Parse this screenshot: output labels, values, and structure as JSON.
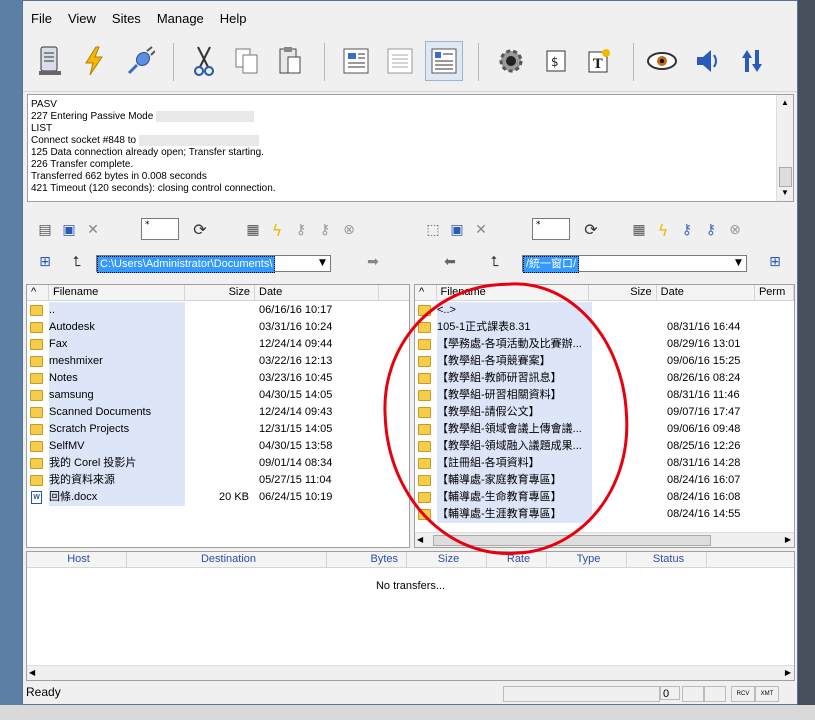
{
  "menu": [
    "File",
    "View",
    "Sites",
    "Manage",
    "Help"
  ],
  "toolbar_icons": [
    "server-icon",
    "lightning-icon",
    "plug-icon",
    "cut-icon",
    "copy-icon",
    "paste-icon",
    "view-text-icon",
    "view-list-icon",
    "view-detail-icon",
    "settings-gear-icon",
    "script-icon",
    "text-file-icon",
    "eye-icon",
    "speaker-icon",
    "transfer-arrows-icon"
  ],
  "log": {
    "lines": [
      "PASV",
      "227 Entering Passive Mode",
      "LIST",
      "Connect socket #848 to",
      "125 Data connection already open; Transfer starting.",
      "226 Transfer complete.",
      "Transferred 662 bytes in 0.008 seconds",
      "421 Timeout (120 seconds): closing control connection."
    ]
  },
  "local": {
    "filter": "*",
    "path": "C:\\Users\\Administrator\\Documents\\",
    "columns": {
      "name": "Filename",
      "size": "Size",
      "date": "Date"
    },
    "files": [
      {
        "name": "..",
        "size": "",
        "date": "06/16/16",
        "time": "10:17",
        "type": "folder"
      },
      {
        "name": "Autodesk",
        "size": "",
        "date": "03/31/16",
        "time": "10:24",
        "type": "folder"
      },
      {
        "name": "Fax",
        "size": "",
        "date": "12/24/14",
        "time": "09:44",
        "type": "folder"
      },
      {
        "name": "meshmixer",
        "size": "",
        "date": "03/22/16",
        "time": "12:13",
        "type": "folder"
      },
      {
        "name": "Notes",
        "size": "",
        "date": "03/23/16",
        "time": "10:45",
        "type": "folder"
      },
      {
        "name": "samsung",
        "size": "",
        "date": "04/30/15",
        "time": "14:05",
        "type": "folder"
      },
      {
        "name": "Scanned Documents",
        "size": "",
        "date": "12/24/14",
        "time": "09:43",
        "type": "folder"
      },
      {
        "name": "Scratch Projects",
        "size": "",
        "date": "12/31/15",
        "time": "14:05",
        "type": "folder"
      },
      {
        "name": "SelfMV",
        "size": "",
        "date": "04/30/15",
        "time": "13:58",
        "type": "folder"
      },
      {
        "name": "我的 Corel 投影片",
        "size": "",
        "date": "09/01/14",
        "time": "08:34",
        "type": "folder"
      },
      {
        "name": "我的資料來源",
        "size": "",
        "date": "05/27/15",
        "time": "11:04",
        "type": "folder"
      },
      {
        "name": "回條.docx",
        "size": "20 KB",
        "date": "06/24/15",
        "time": "10:19",
        "type": "doc"
      }
    ]
  },
  "remote": {
    "filter": "*",
    "path": "/統一窗口/",
    "columns": {
      "name": "Filename",
      "size": "Size",
      "date": "Date",
      "perm": "Perm"
    },
    "files": [
      {
        "name": "<..>",
        "date": "",
        "time": ""
      },
      {
        "name": "105-1正式課表8.31",
        "date": "08/31/16",
        "time": "16:44"
      },
      {
        "name": "【學務處-各項活動及比賽辦...",
        "date": "08/29/16",
        "time": "13:01"
      },
      {
        "name": "【教學組-各項競賽案】",
        "date": "09/06/16",
        "time": "15:25"
      },
      {
        "name": "【教學組-教師研習訊息】",
        "date": "08/26/16",
        "time": "08:24"
      },
      {
        "name": "【教學組-研習相關資料】",
        "date": "08/31/16",
        "time": "11:46"
      },
      {
        "name": "【教學組-請假公文】",
        "date": "09/07/16",
        "time": "17:47"
      },
      {
        "name": "【教學組-領域會議上傳會議...",
        "date": "09/06/16",
        "time": "09:48"
      },
      {
        "name": "【教學組-領域融入議題成果...",
        "date": "08/25/16",
        "time": "12:26"
      },
      {
        "name": "【註冊組-各項資料】",
        "date": "08/31/16",
        "time": "14:28"
      },
      {
        "name": "【輔導處-家庭教育專區】",
        "date": "08/24/16",
        "time": "16:07"
      },
      {
        "name": "【輔導處-生命教育專區】",
        "date": "08/24/16",
        "time": "16:08"
      },
      {
        "name": "【輔導處-生涯教育專區】",
        "date": "08/24/16",
        "time": "14:55"
      }
    ]
  },
  "queue": {
    "columns": [
      "Host",
      "Destination",
      "Bytes",
      "Size",
      "Rate",
      "Type",
      "Status"
    ],
    "empty_message": "No transfers..."
  },
  "status": {
    "text": "Ready",
    "count": "0",
    "btn1": "RCV",
    "btn2": "XMT"
  },
  "colors": {
    "annotation": "#e8000f",
    "selection": "#3399ff",
    "row_highlight": "#dde6f8"
  }
}
